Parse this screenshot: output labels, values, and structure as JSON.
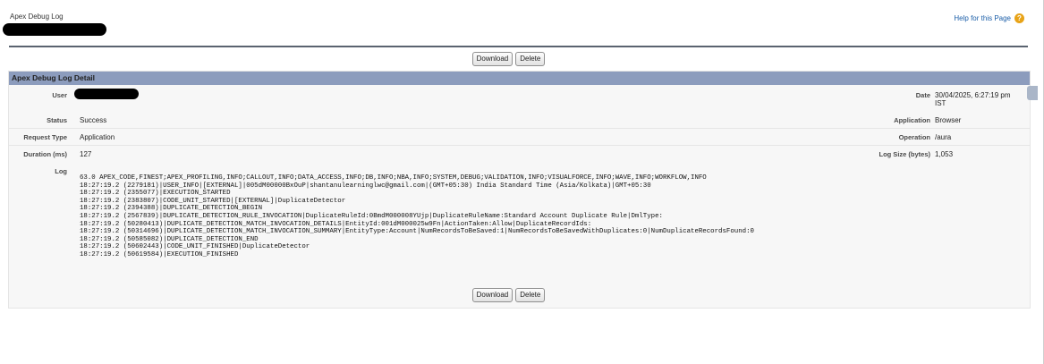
{
  "page": {
    "subtitle": "Apex Debug Log",
    "help_link": "Help for this Page",
    "help_icon": "question-circle-icon"
  },
  "buttons": {
    "download": "Download",
    "delete": "Delete"
  },
  "detail": {
    "header": "Apex Debug Log Detail",
    "fields": {
      "user_label": "User",
      "date_label": "Date",
      "date_value": "30/04/2025, 6:27:19 pm IST",
      "status_label": "Status",
      "status_value": "Success",
      "application_label": "Application",
      "application_value": "Browser",
      "request_type_label": "Request Type",
      "request_type_value": "Application",
      "operation_label": "Operation",
      "operation_value": "/aura",
      "duration_label": "Duration (ms)",
      "duration_value": "127",
      "log_size_label": "Log Size (bytes)",
      "log_size_value": "1,053",
      "log_label": "Log"
    },
    "log_lines": [
      "63.0 APEX_CODE,FINEST;APEX_PROFILING,INFO;CALLOUT,INFO;DATA_ACCESS,INFO;DB,INFO;NBA,INFO;SYSTEM,DEBUG;VALIDATION,INFO;VISUALFORCE,INFO;WAVE,INFO;WORKFLOW,INFO",
      "18:27:19.2 (2279181)|USER_INFO|[EXTERNAL]|005dM00000BxOuP|shantanulearninglwc@gmail.com|(GMT+05:30) India Standard Time (Asia/Kolkata)|GMT+05:30",
      "18:27:19.2 (2355077)|EXECUTION_STARTED",
      "18:27:19.2 (2383807)|CODE_UNIT_STARTED|[EXTERNAL]|DuplicateDetector",
      "18:27:19.2 (2394388)|DUPLICATE_DETECTION_BEGIN",
      "18:27:19.2 (2567839)|DUPLICATE_DETECTION_RULE_INVOCATION|DuplicateRuleId:0BmdM000008YUjp|DuplicateRuleName:Standard Account Duplicate Rule|DmlType:",
      "18:27:19.2 (50280413)|DUPLICATE_DETECTION_MATCH_INVOCATION_DETAILS|EntityId:001dM000025w9Fn|ActionTaken:Allow|DuplicateRecordIds:",
      "18:27:19.2 (50314696)|DUPLICATE_DETECTION_MATCH_INVOCATION_SUMMARY|EntityType:Account|NumRecordsToBeSaved:1|NumRecordsToBeSavedWithDuplicates:0|NumDuplicateRecordsFound:0",
      "18:27:19.2 (50585082)|DUPLICATE_DETECTION_END",
      "18:27:19.2 (50602443)|CODE_UNIT_FINISHED|DuplicateDetector",
      "18:27:19.2 (50619584)|EXECUTION_FINISHED"
    ]
  }
}
